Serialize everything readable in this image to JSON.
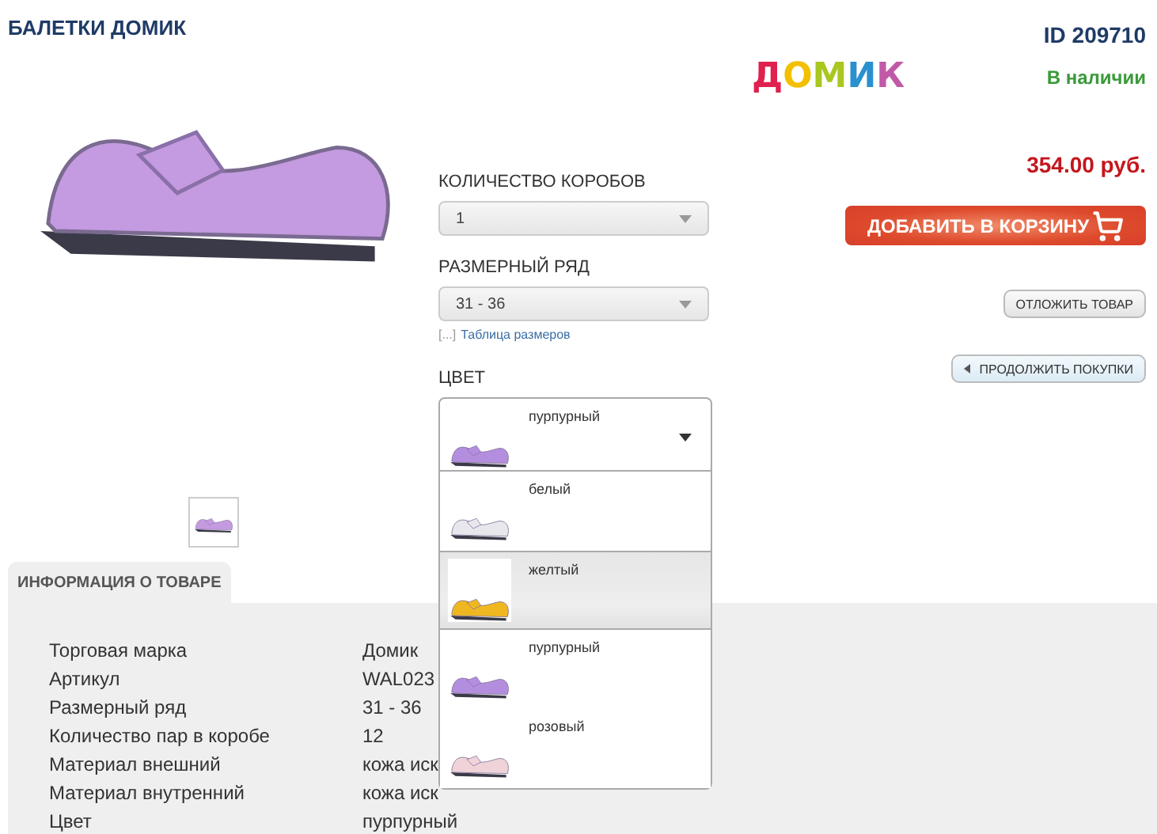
{
  "title": "БАЛЕТКИ ДОМИК",
  "product_id": "ID 209710",
  "brand_logo": "ДОМИК",
  "availability": "В наличии",
  "price": "354.00 руб.",
  "options": [
    {
      "label": "КОЛИЧЕСТВО КОРОБОВ",
      "value": "1"
    },
    {
      "label": "РАЗМЕРНЫЙ РЯД",
      "value": "31 - 36",
      "link_prefix": "[...]",
      "link": "Таблица размеров"
    }
  ],
  "color_select": {
    "label": "ЦВЕТ",
    "value": "пурпурный",
    "color": "#b48ede",
    "expanded": true,
    "options": [
      {
        "name": "белый",
        "color": "#e8e8ec",
        "highlighted": false
      },
      {
        "name": "желтый",
        "color": "#f0b820",
        "highlighted": true
      },
      {
        "name": "пурпурный",
        "color": "#b48ede",
        "highlighted": false
      },
      {
        "name": "розовый",
        "color": "#efd3d8",
        "highlighted": false
      }
    ]
  },
  "buttons": {
    "add_to_cart": "ДОБАВИТЬ В КОРЗИНУ",
    "save": "ОТЛОЖИТЬ ТОВАР",
    "continue": "ПРОДОЛЖИТЬ ПОКУПКИ"
  },
  "info_tab": "ИНФОРМАЦИЯ О ТОВАРЕ",
  "specs": [
    {
      "name": "Торговая марка",
      "value": "Домик"
    },
    {
      "name": "Артикул",
      "value": "WAL023"
    },
    {
      "name": "Размерный ряд",
      "value": "31 - 36"
    },
    {
      "name": "Количество пар в коробе",
      "value": "12"
    },
    {
      "name": "Материал внешний",
      "value": "кожа иск"
    },
    {
      "name": "Материал внутренний",
      "value": "кожа иск"
    },
    {
      "name": "Цвет",
      "value": "пурпурный"
    }
  ]
}
